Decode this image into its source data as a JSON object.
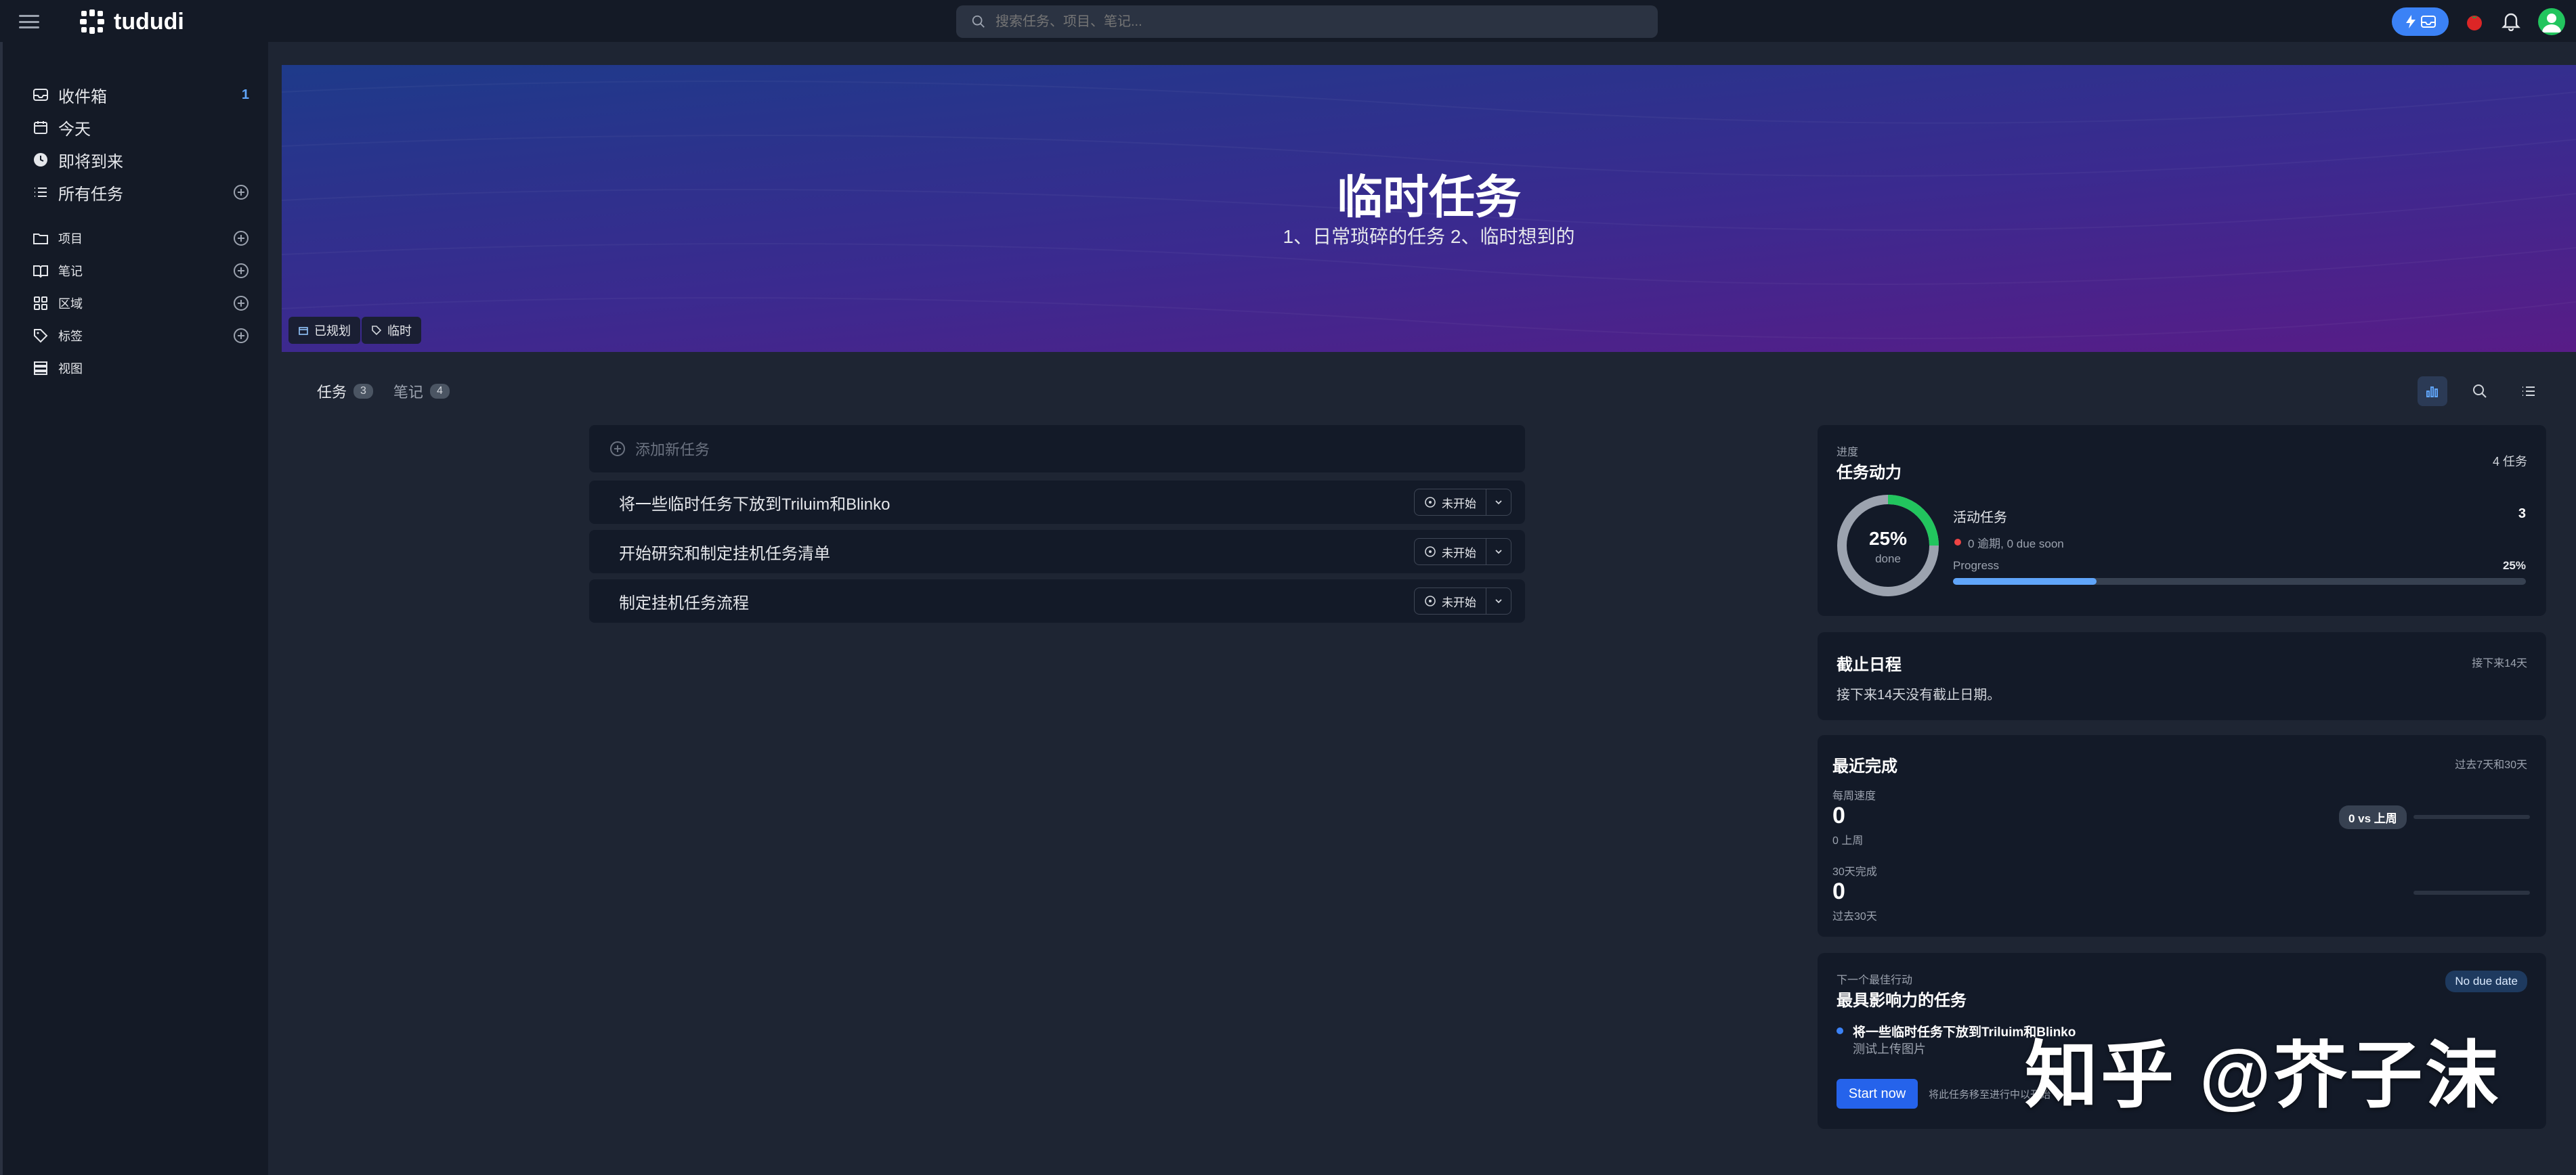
{
  "app": {
    "name": "tududi"
  },
  "search": {
    "placeholder": "搜索任务、项目、笔记..."
  },
  "sidebar": {
    "items": [
      {
        "label": "收件箱",
        "count": "1"
      },
      {
        "label": "今天"
      },
      {
        "label": "即将到来"
      },
      {
        "label": "所有任务"
      },
      {
        "label": "项目"
      },
      {
        "label": "笔记"
      },
      {
        "label": "区域"
      },
      {
        "label": "标签"
      },
      {
        "label": "视图"
      }
    ]
  },
  "banner": {
    "title": "临时任务",
    "subtitle": "1、日常琐碎的任务 2、临时想到的",
    "chips": [
      {
        "label": "已规划"
      },
      {
        "label": "临时"
      }
    ]
  },
  "tabs": [
    {
      "label": "任务",
      "count": "3"
    },
    {
      "label": "笔记",
      "count": "4"
    }
  ],
  "tasks": {
    "add_placeholder": "添加新任务",
    "items": [
      {
        "title": "将一些临时任务下放到Triluim和Blinko",
        "status": "未开始"
      },
      {
        "title": "开始研究和制定挂机任务清单",
        "status": "未开始"
      },
      {
        "title": "制定挂机任务流程",
        "status": "未开始"
      }
    ]
  },
  "momentum": {
    "eyebrow": "进度",
    "title": "任务动力",
    "total": "4 任务",
    "percent": "25%",
    "done_label": "done",
    "active_label": "活动任务",
    "active_count": "3",
    "overdue_text": "0 逾期, 0 due soon",
    "progress_label": "Progress",
    "progress_value": "25%",
    "progress_fraction": 0.25,
    "colors": {
      "ring": "#22c55e",
      "track": "#9ca3af",
      "bar": "#60a5fa",
      "overdue_dot": "#ef4444"
    }
  },
  "deadlines": {
    "title": "截止日程",
    "range": "接下来14天",
    "empty": "接下来14天没有截止日期。"
  },
  "recent": {
    "title": "最近完成",
    "range": "过去7天和30天",
    "weekly_label": "每周速度",
    "weekly_value": "0",
    "weekly_sub": "0 上周",
    "compare_badge": "0 vs 上周",
    "monthly_label": "30天完成",
    "monthly_value": "0",
    "monthly_sub": "过去30天"
  },
  "next_action": {
    "eyebrow": "下一个最佳行动",
    "title": "最具影响力的任务",
    "due_badge": "No due date",
    "task_title": "将一些临时任务下放到Triluim和Blinko",
    "task_sub": "测试上传图片",
    "button": "Start now",
    "hint": "将此任务移至进行中以开始"
  },
  "watermark": "知乎 @芥子沫"
}
